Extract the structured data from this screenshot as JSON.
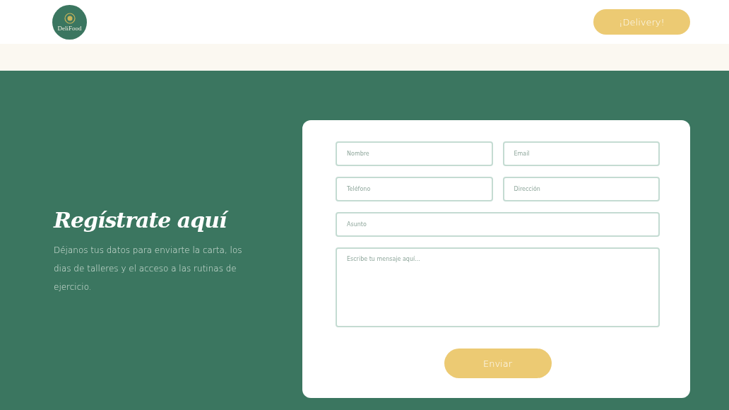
{
  "header": {
    "logo_text": "DeliFood",
    "delivery_button": "¡Delivery!"
  },
  "intro": {
    "title": "Regístrate aquí",
    "text": "Déjanos tus datos para enviarte la carta, los dias de talleres y el acceso a las rutinas de ejercicio."
  },
  "form": {
    "fields": [
      {
        "kind": "input",
        "placeholder": "Nombre"
      },
      {
        "kind": "input",
        "placeholder": "Email"
      },
      {
        "kind": "input",
        "placeholder": "Teléfono"
      },
      {
        "kind": "input",
        "placeholder": "Dirección"
      },
      {
        "kind": "wide-input",
        "placeholder": "Asunto"
      },
      {
        "kind": "textarea",
        "placeholder": "Escribe tu mensaje aquí..."
      }
    ],
    "submit": "Enviar"
  }
}
